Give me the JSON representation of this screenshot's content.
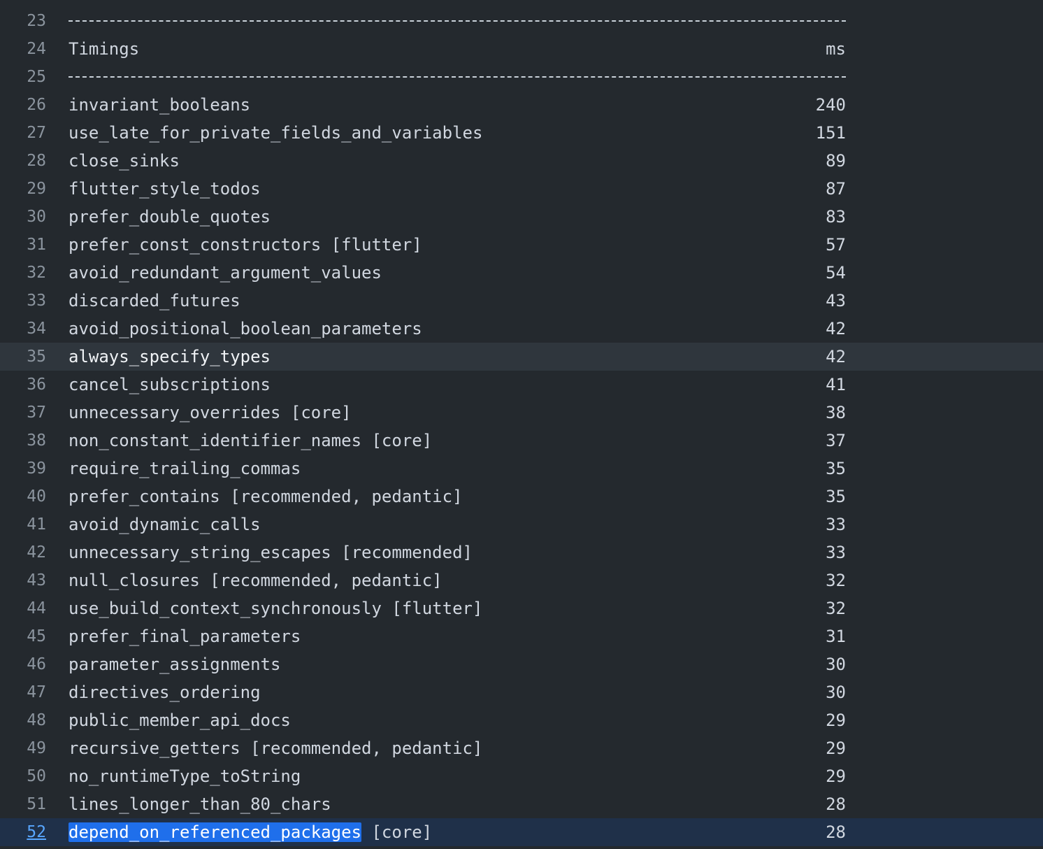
{
  "log": {
    "lines": [
      {
        "n": "23",
        "type": "rule"
      },
      {
        "n": "24",
        "type": "header",
        "name": "Timings",
        "value": "ms"
      },
      {
        "n": "25",
        "type": "rule"
      },
      {
        "n": "26",
        "type": "entry",
        "name": "invariant_booleans",
        "value": "240"
      },
      {
        "n": "27",
        "type": "entry",
        "name": "use_late_for_private_fields_and_variables",
        "value": "151"
      },
      {
        "n": "28",
        "type": "entry",
        "name": "close_sinks",
        "value": "89"
      },
      {
        "n": "29",
        "type": "entry",
        "name": "flutter_style_todos",
        "value": "87"
      },
      {
        "n": "30",
        "type": "entry",
        "name": "prefer_double_quotes",
        "value": "83"
      },
      {
        "n": "31",
        "type": "entry",
        "name": "prefer_const_constructors [flutter]",
        "value": "57"
      },
      {
        "n": "32",
        "type": "entry",
        "name": "avoid_redundant_argument_values",
        "value": "54"
      },
      {
        "n": "33",
        "type": "entry",
        "name": "discarded_futures",
        "value": "43"
      },
      {
        "n": "34",
        "type": "entry",
        "name": "avoid_positional_boolean_parameters",
        "value": "42"
      },
      {
        "n": "35",
        "type": "entry",
        "name": "always_specify_types",
        "value": "42",
        "state": "hover"
      },
      {
        "n": "36",
        "type": "entry",
        "name": "cancel_subscriptions",
        "value": "41"
      },
      {
        "n": "37",
        "type": "entry",
        "name": "unnecessary_overrides [core]",
        "value": "38"
      },
      {
        "n": "38",
        "type": "entry",
        "name": "non_constant_identifier_names [core]",
        "value": "37"
      },
      {
        "n": "39",
        "type": "entry",
        "name": "require_trailing_commas",
        "value": "35"
      },
      {
        "n": "40",
        "type": "entry",
        "name": "prefer_contains [recommended, pedantic]",
        "value": "35"
      },
      {
        "n": "41",
        "type": "entry",
        "name": "avoid_dynamic_calls",
        "value": "33"
      },
      {
        "n": "42",
        "type": "entry",
        "name": "unnecessary_string_escapes [recommended]",
        "value": "33"
      },
      {
        "n": "43",
        "type": "entry",
        "name": "null_closures [recommended, pedantic]",
        "value": "32"
      },
      {
        "n": "44",
        "type": "entry",
        "name": "use_build_context_synchronously [flutter]",
        "value": "32"
      },
      {
        "n": "45",
        "type": "entry",
        "name": "prefer_final_parameters",
        "value": "31"
      },
      {
        "n": "46",
        "type": "entry",
        "name": "parameter_assignments",
        "value": "30"
      },
      {
        "n": "47",
        "type": "entry",
        "name": "directives_ordering",
        "value": "30"
      },
      {
        "n": "48",
        "type": "entry",
        "name": "public_member_api_docs",
        "value": "29"
      },
      {
        "n": "49",
        "type": "entry",
        "name": "recursive_getters [recommended, pedantic]",
        "value": "29"
      },
      {
        "n": "50",
        "type": "entry",
        "name": "no_runtimeType_toString",
        "value": "29"
      },
      {
        "n": "51",
        "type": "entry",
        "name": "lines_longer_than_80_chars",
        "value": "28"
      },
      {
        "n": "52",
        "type": "entry",
        "name": "depend_on_referenced_packages [core]",
        "highlight": "depend_on_referenced_packages",
        "rest": " [core]",
        "value": "28",
        "state": "selected"
      }
    ]
  },
  "colors": {
    "background": "#24292e",
    "hover_row": "#2f363d",
    "selected_row": "#1f3049",
    "search_highlight": "#1f6feb",
    "line_number": "#8b949e",
    "selected_line_number": "#58a6ff"
  }
}
